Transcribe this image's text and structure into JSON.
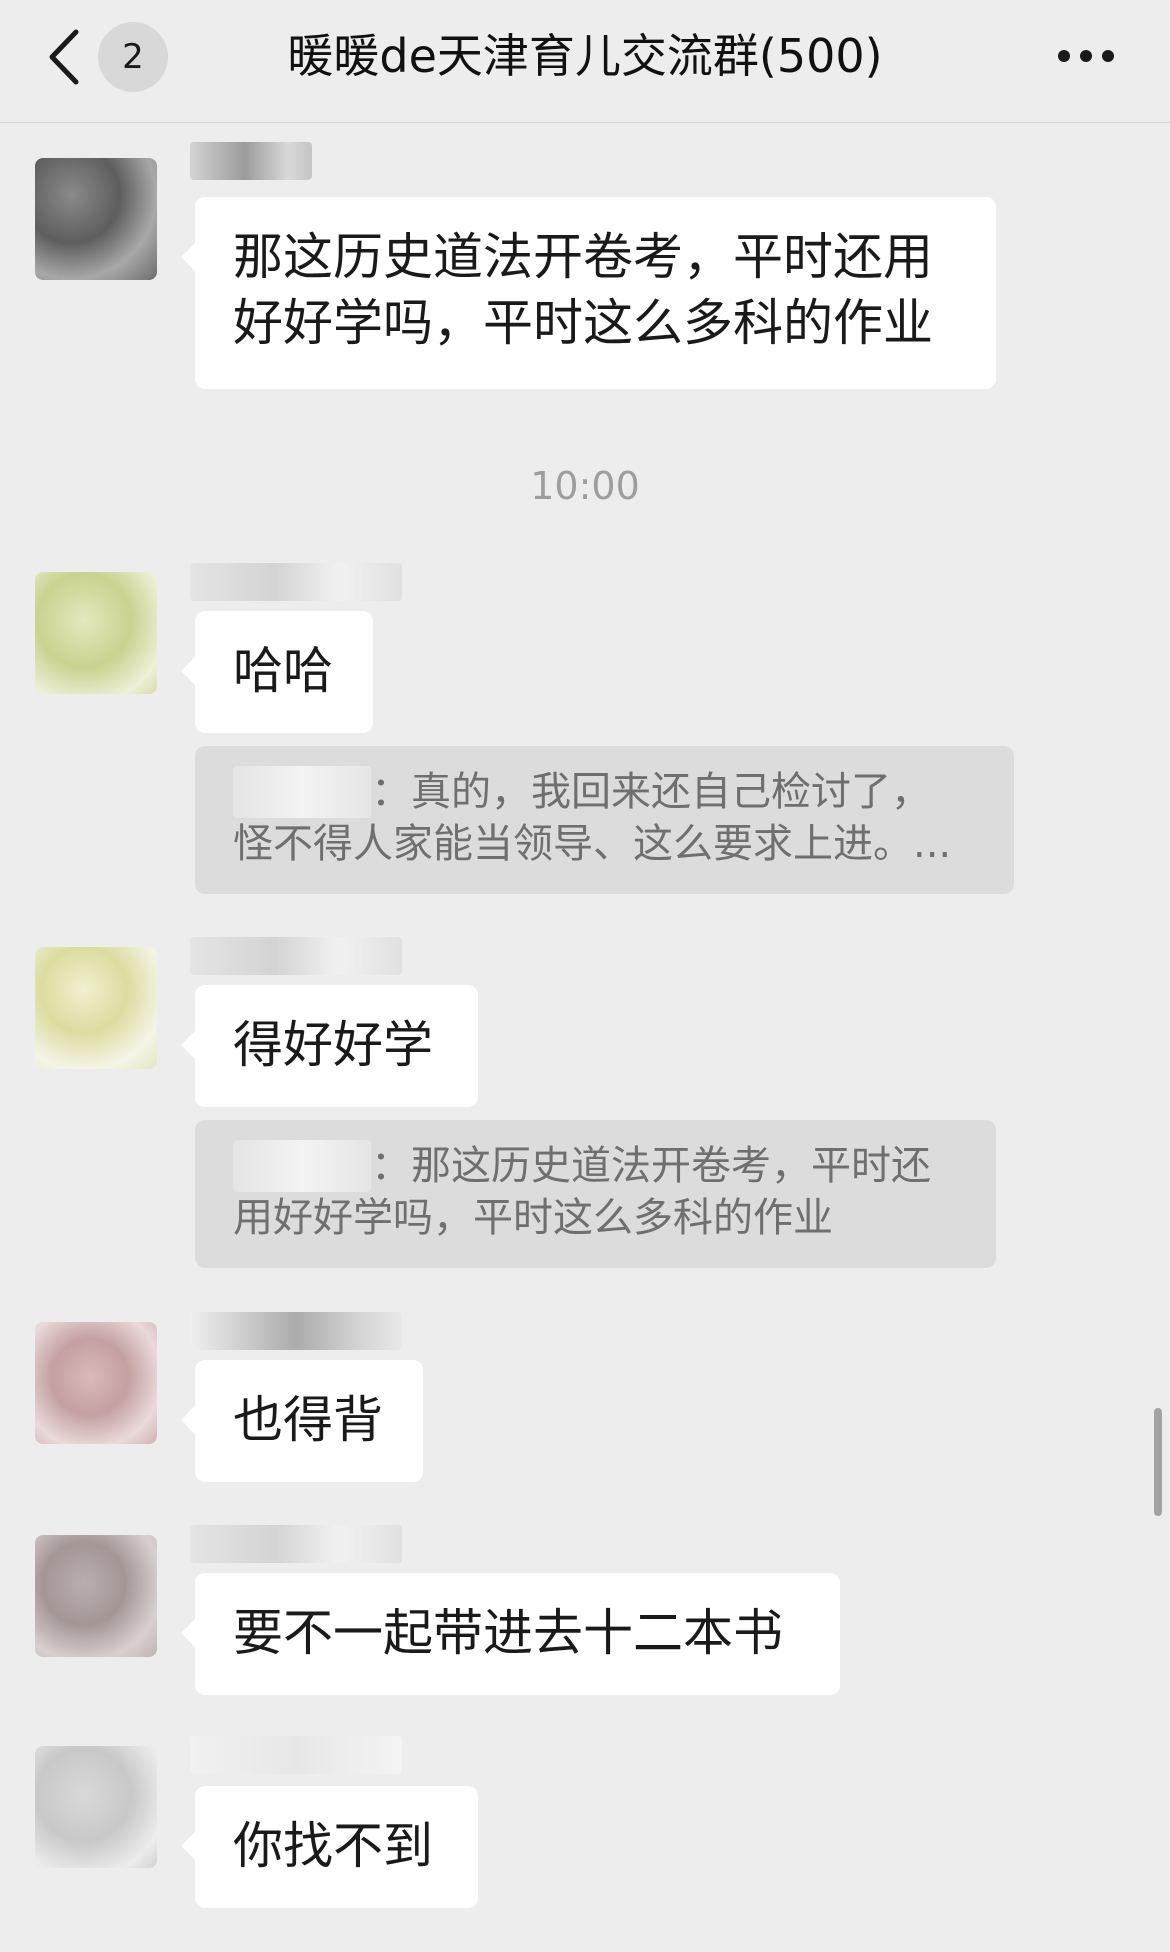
{
  "header": {
    "unread_count": "2",
    "title": "暖暖de天津育儿交流群(500)"
  },
  "messages": [
    {
      "text_lines": [
        "那这历史道法开卷考，平时还用",
        "好好学吗，平时这么多科的作业"
      ]
    },
    {
      "text": "哈哈",
      "quote": {
        "lines": [
          "：真的，我回来还自己检讨了，",
          "怪不得人家能当领导、这么要求上进。..."
        ]
      }
    },
    {
      "text": "得好好学",
      "quote": {
        "lines": [
          "：那这历史道法开卷考，平时还",
          "用好好学吗，平时这么多科的作业"
        ]
      }
    },
    {
      "text": "也得背"
    },
    {
      "text": "要不一起带进去十二本书"
    },
    {
      "text": "你找不到"
    }
  ],
  "timestamp": "10:00",
  "colors": {
    "background": "#ededed",
    "bubble": "#ffffff",
    "quote": "#dcdcdc",
    "timestamp": "#9e9e9e"
  },
  "icons": [
    "back-arrow-icon",
    "more-options-icon"
  ]
}
